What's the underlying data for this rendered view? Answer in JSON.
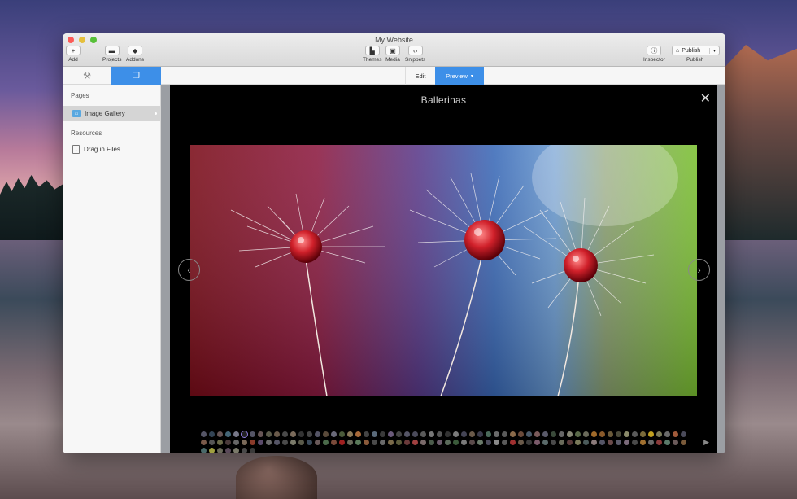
{
  "window": {
    "title": "My Website"
  },
  "toolbar": {
    "add": "Add",
    "projects": "Projects",
    "addons": "Addons",
    "themes": "Themes",
    "media": "Media",
    "snippets": "Snippets",
    "inspector": "Inspector",
    "publish_button": "Publish",
    "publish_label": "Publish"
  },
  "modes": {
    "edit": "Edit",
    "preview": "Preview"
  },
  "sidebar": {
    "pages_header": "Pages",
    "pages": [
      {
        "label": "Image Gallery"
      }
    ],
    "resources_header": "Resources",
    "resources": [
      {
        "label": "Drag in Files..."
      }
    ]
  },
  "gallery": {
    "title": "Ballerinas",
    "thumbnail_colors": [
      "#556",
      "#345",
      "#655",
      "#467",
      "#778",
      "#222",
      "#556",
      "#655",
      "#5a5a4a",
      "#6a5a4a",
      "#4a4a4a",
      "#7a6a5a",
      "#333",
      "#444",
      "#556",
      "#5a4a3a",
      "#6a6a7a",
      "#4a5a3a",
      "#8a7a5a",
      "#a86a3a",
      "#444",
      "#5a6a7a",
      "#3a3a3a",
      "#6a5a7a",
      "#444",
      "#556",
      "#4a4a5a",
      "#5a5a5a",
      "#777",
      "#555",
      "#333",
      "#7a7a7a",
      "#445",
      "#6a5a4a",
      "#3a3a4a",
      "#4a6a5a",
      "#6a6a6a",
      "#5a5a5a",
      "#8a6a4a",
      "#6a4a3a",
      "#4a5a6a",
      "#7a5a5a",
      "#5a5a6a",
      "#3a4a3a",
      "#666",
      "#887",
      "#5a6a4a",
      "#6a6a5a",
      "#a06a2a",
      "#8a5a2a",
      "#6a5a3a",
      "#4a4a3a",
      "#8a8a6a",
      "#5a5a5a",
      "#7a6a3a",
      "#c0a020",
      "#7a7a5a",
      "#6a6a6a",
      "#a05a3a",
      "#4a4a5a",
      "#7a5a4a",
      "#555",
      "#6a6a4a",
      "#4a3a3a",
      "#666",
      "#7a6a5a",
      "#8a3a2a",
      "#5a4a6a",
      "#6a6a6a",
      "#556",
      "#4a4a4a",
      "#7a7a6a",
      "#5a5a4a",
      "#3a4a5a",
      "#6a5a5a",
      "#4a6a4a",
      "#7a4a3a",
      "#a02020",
      "#6a6a5a",
      "#5a7a5a",
      "#8a5a3a",
      "#4a4a4a",
      "#6a6a6a",
      "#7a6a4a",
      "#5a5a3a",
      "#6a3a3a",
      "#a04040",
      "#7a6a6a",
      "#4a5a4a",
      "#6a5a6a",
      "#5a6a5a",
      "#3a5a3a",
      "#7a7a7a",
      "#5a4a4a",
      "#6a7a6a",
      "#4a4a5a",
      "#8a8a8a",
      "#5a5a5a",
      "#a03030",
      "#6a5a4a",
      "#3a3a3a",
      "#7a5a6a",
      "#5a6a6a",
      "#4a4a4a",
      "#6a6a5a",
      "#5a3a3a",
      "#7a7a5a",
      "#4a5a5a",
      "#8a7a7a",
      "#556",
      "#6a4a4a",
      "#5a5a6a",
      "#7a6a7a",
      "#4a4a4a",
      "#a07030",
      "#6a6a6a",
      "#8a3a3a",
      "#5a7a6a",
      "#6a5a5a",
      "#7a5a3a",
      "#4a6a6a",
      "#a0a040",
      "#6a6a5a",
      "#5a4a5a",
      "#7a7a6a",
      "#4a4a4a",
      "#3a3a3a"
    ]
  }
}
